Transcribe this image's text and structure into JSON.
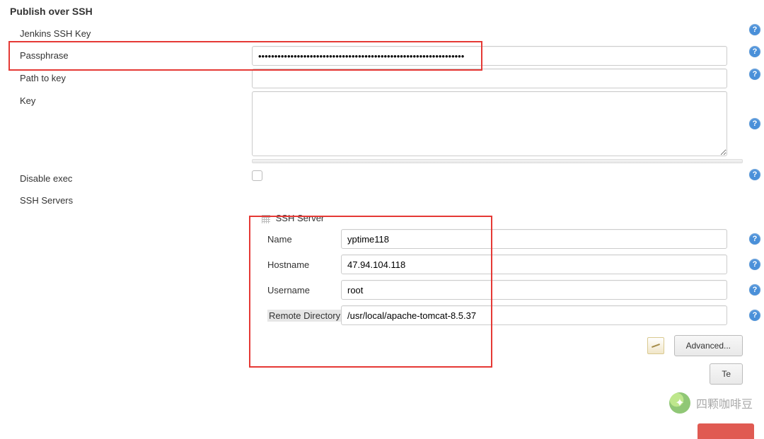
{
  "section_title": "Publish over SSH",
  "labels": {
    "jenkins_ssh_key": "Jenkins SSH Key",
    "passphrase": "Passphrase",
    "path_to_key": "Path to key",
    "key": "Key",
    "disable_exec": "Disable exec",
    "ssh_servers": "SSH Servers"
  },
  "values": {
    "passphrase": "••••••••••••••••••••••••••••••••••••••••••••••••••••••••••••••••",
    "path_to_key": "",
    "key": "",
    "disable_exec_checked": false
  },
  "server": {
    "header": "SSH Server",
    "name_label": "Name",
    "hostname_label": "Hostname",
    "username_label": "Username",
    "remote_dir_label": "Remote Directory",
    "name": "yptime118",
    "hostname": "47.94.104.118",
    "username": "root",
    "remote_directory": "/usr/local/apache-tomcat-8.5.37"
  },
  "buttons": {
    "advanced": "Advanced...",
    "test": "Te"
  },
  "watermark": "四颗咖啡豆"
}
